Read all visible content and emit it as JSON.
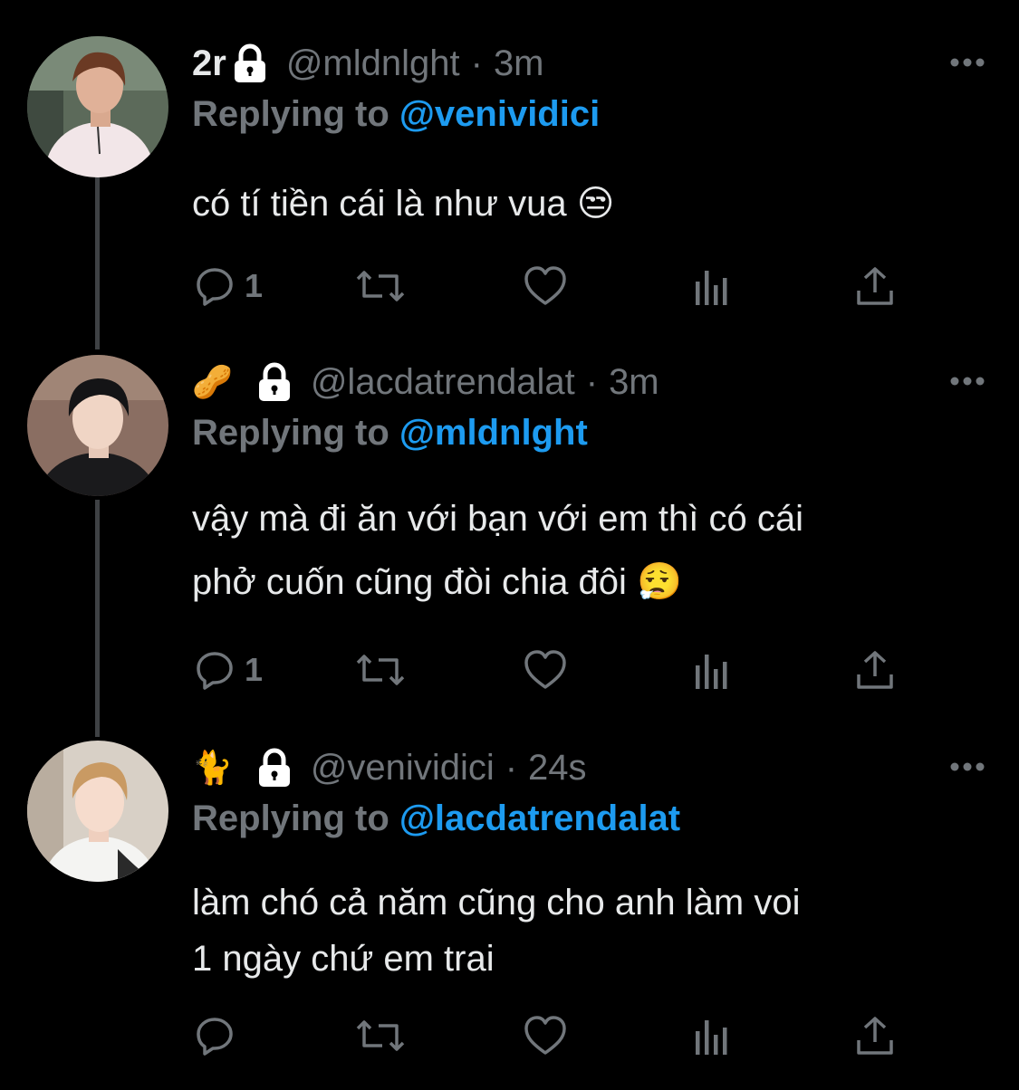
{
  "colors": {
    "background": "#000000",
    "text_primary": "#e7e9ea",
    "text_secondary": "#71767b",
    "accent": "#1d9bf0",
    "thread_line": "#3e4144"
  },
  "tweets": [
    {
      "display_name": "2r",
      "name_emoji": "",
      "handle": "@mldnlght",
      "separator": "·",
      "time": "3m",
      "reply_prefix": "Replying to",
      "reply_to": "@venividici",
      "text_lines": [
        "có tí tiền cái là như vua 😒"
      ],
      "reply_count": "1",
      "icons": [
        "lock-icon",
        "more-icon",
        "reply-icon",
        "retweet-icon",
        "like-icon",
        "views-icon",
        "share-icon"
      ]
    },
    {
      "display_name": "",
      "name_emoji": "🥜",
      "handle": "@lacdatrendalat",
      "separator": "·",
      "time": "3m",
      "reply_prefix": "Replying to",
      "reply_to": "@mldnlght",
      "text_lines": [
        "vậy mà đi ăn với bạn với em thì có cái",
        "phở cuốn cũng đòi chia đôi 😮‍💨"
      ],
      "reply_count": "1",
      "icons": [
        "lock-icon",
        "more-icon",
        "reply-icon",
        "retweet-icon",
        "like-icon",
        "views-icon",
        "share-icon"
      ]
    },
    {
      "display_name": "",
      "name_emoji": "🐈",
      "handle": "@venividici",
      "separator": "·",
      "time": "24s",
      "reply_prefix": "Replying to",
      "reply_to": "@lacdatrendalat",
      "text_lines": [
        "làm chó cả năm cũng cho anh làm voi",
        "1 ngày chứ em trai"
      ],
      "reply_count": "",
      "icons": [
        "lock-icon",
        "more-icon",
        "reply-icon",
        "retweet-icon",
        "like-icon",
        "views-icon",
        "share-icon"
      ]
    }
  ]
}
